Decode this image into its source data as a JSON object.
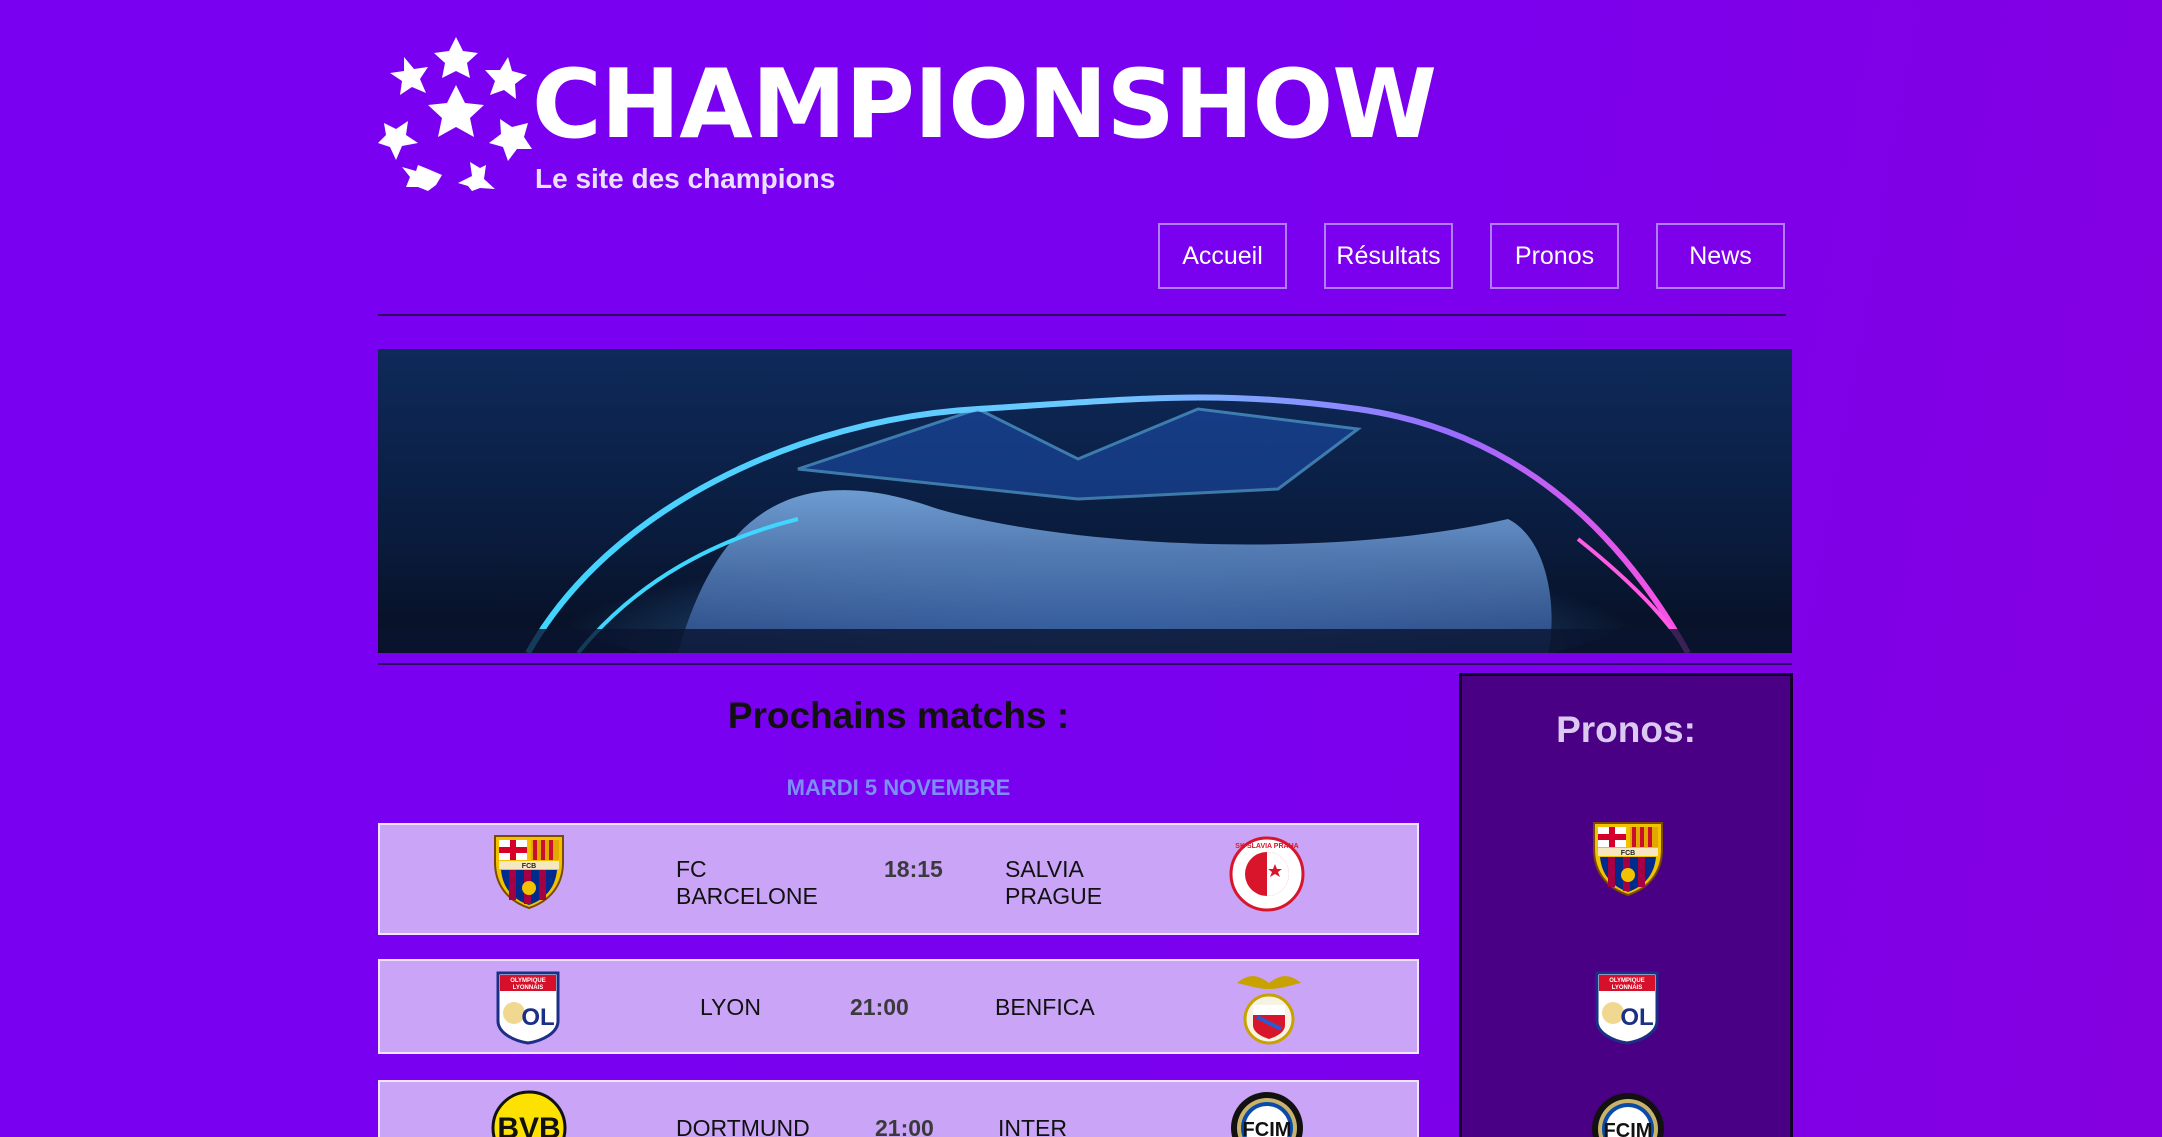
{
  "header": {
    "brand": "CHAMPIONSHOW",
    "tagline": "Le site des champions"
  },
  "nav": [
    {
      "label": "Accueil"
    },
    {
      "label": "Résultats"
    },
    {
      "label": "Pronos"
    },
    {
      "label": "News"
    }
  ],
  "matches": {
    "title": "Prochains matchs :",
    "date": "MARDI 5 NOVEMBRE",
    "list": [
      {
        "home_line1": "FC",
        "home_line2": "BARCELONE",
        "time": "18:15",
        "away_line1": "SALVIA",
        "away_line2": "PRAGUE"
      },
      {
        "home_line1": "LYON",
        "time": "21:00",
        "away_line1": "BENFICA"
      },
      {
        "home_line1": "DORTMUND",
        "time": "21:00",
        "away_line1": "INTER"
      }
    ]
  },
  "crests": {
    "fcb": "FCB",
    "ol_top": "OLYMPIQUE LYONNAIS",
    "ol": "OL",
    "bvb": "BVB",
    "slavia": "SK SLAVIA PRAHA",
    "inter": "FCIM"
  },
  "pronos": {
    "title": "Pronos:"
  },
  "colors": {
    "background": "#7a00f2",
    "match_card": "#c9a4f7",
    "sidebar": "#4a0085",
    "date": "#7c8ff7"
  }
}
